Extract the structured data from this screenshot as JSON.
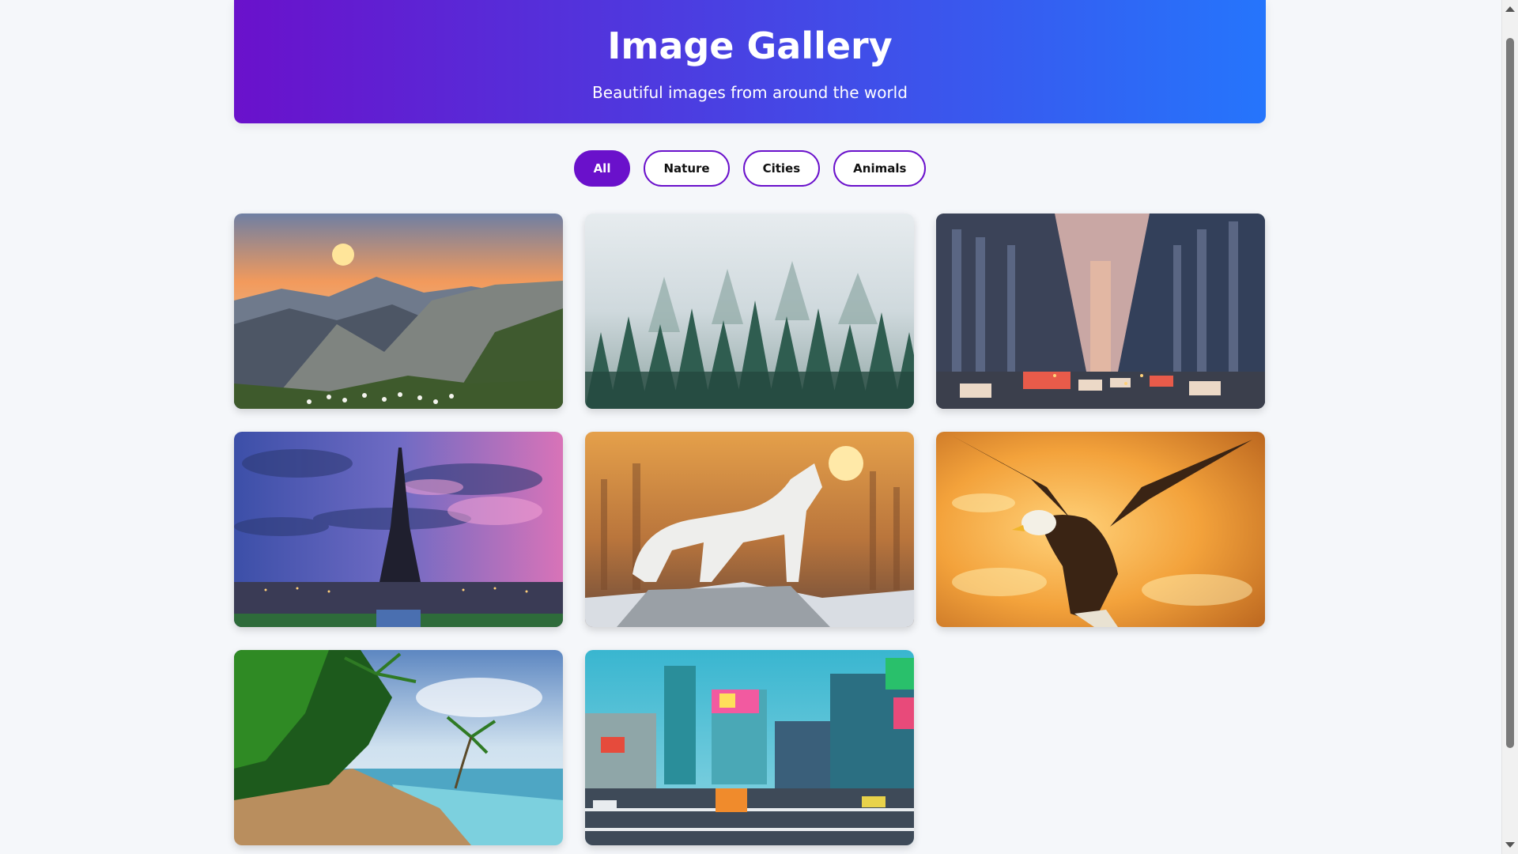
{
  "header": {
    "title": "Image Gallery",
    "subtitle": "Beautiful images from around the world"
  },
  "filters": [
    {
      "label": "All",
      "active": true
    },
    {
      "label": "Nature",
      "active": false
    },
    {
      "label": "Cities",
      "active": false
    },
    {
      "label": "Animals",
      "active": false
    }
  ],
  "gallery": [
    {
      "subject": "mountain-sunset",
      "category": "Nature"
    },
    {
      "subject": "misty-forest",
      "category": "Nature"
    },
    {
      "subject": "city-street",
      "category": "Cities"
    },
    {
      "subject": "eiffel-tower",
      "category": "Cities"
    },
    {
      "subject": "white-wolf",
      "category": "Animals"
    },
    {
      "subject": "bald-eagle",
      "category": "Animals"
    },
    {
      "subject": "tropical-beach",
      "category": "Nature"
    },
    {
      "subject": "tokyo-crossing",
      "category": "Cities"
    }
  ],
  "colors": {
    "accent": "#6a11cb",
    "gradient_end": "#2575fc",
    "background": "#f5f7fa"
  }
}
